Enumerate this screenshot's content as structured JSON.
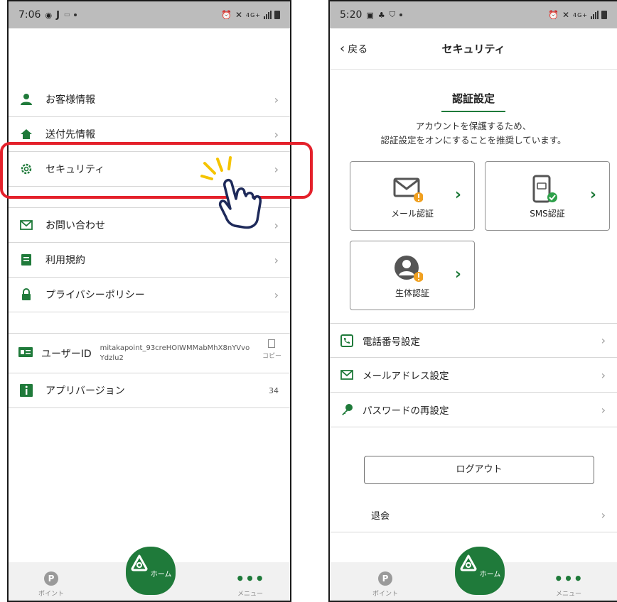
{
  "left": {
    "status": {
      "time": "7:06",
      "icons": [
        "j-icon",
        "mail-icon"
      ],
      "right_icons": "4G+"
    },
    "menu": [
      {
        "label": "お客様情報",
        "icon": "person-icon"
      },
      {
        "label": "送付先情報",
        "icon": "house-icon"
      },
      {
        "label": "セキュリティ",
        "icon": "gear-icon"
      },
      {
        "label": "お問い合わせ",
        "icon": "mail-icon"
      },
      {
        "label": "利用規約",
        "icon": "document-icon"
      },
      {
        "label": "プライバシーポリシー",
        "icon": "lock-icon"
      }
    ],
    "user_id": {
      "label": "ユーザーID",
      "value": "mitakapoint_93creHOIWMMabMhX8nYVvo Ydzlu2",
      "copy_label": "コピー"
    },
    "app_version": {
      "label": "アプリバージョン",
      "value": "34"
    },
    "tabs": {
      "point": "ポイント",
      "home": "ホーム",
      "menu": "メニュー",
      "point_badge": "P"
    }
  },
  "right": {
    "status": {
      "time": "5:20",
      "right_icons": "4G+"
    },
    "nav": {
      "back": "戻る",
      "title": "セキュリティ"
    },
    "section_title": "認証設定",
    "description": [
      "アカウントを保護するため、",
      "認証設定をオンにすることを推奨しています。"
    ],
    "auth_cards": [
      {
        "label": "メール認証",
        "status": "warning"
      },
      {
        "label": "SMS認証",
        "status": "ok"
      },
      {
        "label": "生体認証",
        "status": "warning"
      }
    ],
    "settings": [
      {
        "label": "電話番号設定",
        "icon": "phone-icon"
      },
      {
        "label": "メールアドレス設定",
        "icon": "mail-icon"
      },
      {
        "label": "パスワードの再設定",
        "icon": "key-icon"
      }
    ],
    "logout": "ログアウト",
    "withdraw": "退会",
    "tabs": {
      "point": "ポイント",
      "home": "ホーム",
      "menu": "メニュー",
      "point_badge": "P"
    }
  },
  "colors": {
    "brand_green": "#1f7a3a",
    "highlight_red": "#e4212b",
    "warning_orange": "#f0a020",
    "ok_green": "#2ea04a"
  }
}
